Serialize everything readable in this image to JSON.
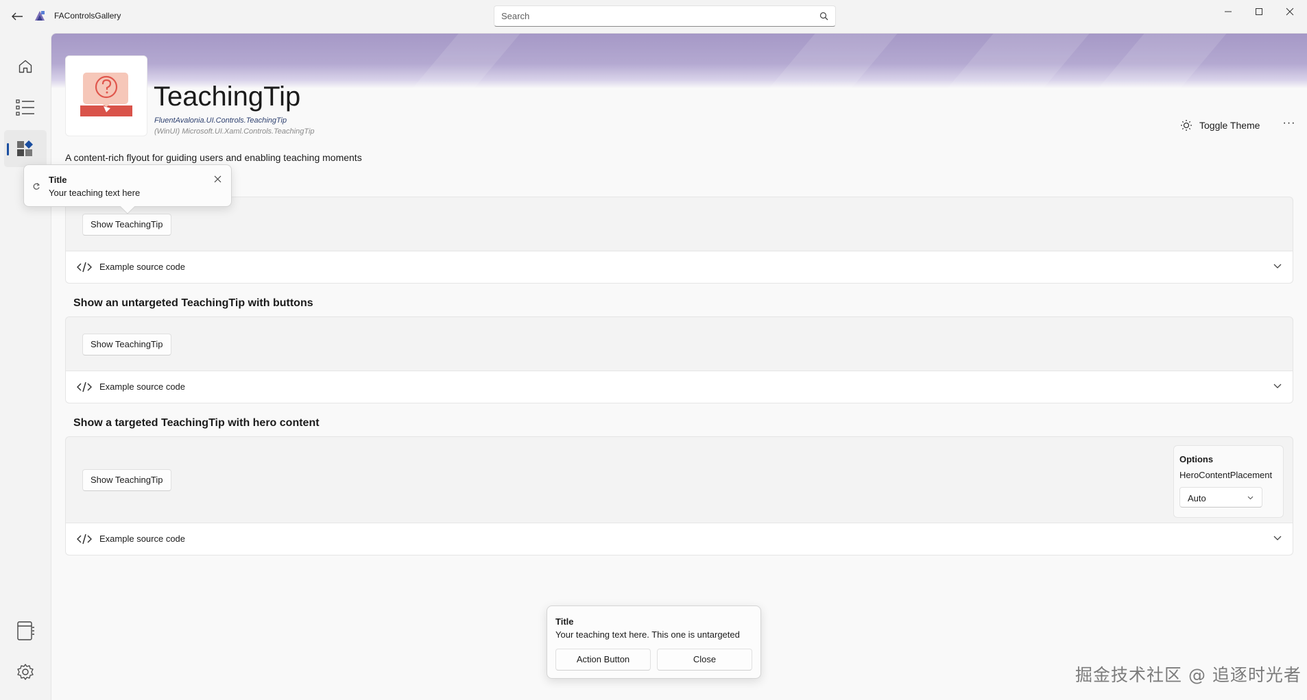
{
  "app": {
    "title": "FAControlsGallery"
  },
  "search": {
    "placeholder": "Search"
  },
  "nav": {
    "items": [
      {
        "icon": "home-icon"
      },
      {
        "icon": "list-icon"
      },
      {
        "icon": "controls-icon",
        "active": true
      }
    ],
    "footer": [
      {
        "icon": "notebook-icon"
      },
      {
        "icon": "gear-icon"
      }
    ]
  },
  "header": {
    "title": "TeachingTip",
    "namespace": "FluentAvalonia.UI.Controls.TeachingTip",
    "winui_namespace": "(WinUI) Microsoft.UI.Xaml.Controls.TeachingTip",
    "toggle_theme": "Toggle Theme",
    "more": "···",
    "description": "A content-rich flyout for guiding users and enabling teaching moments"
  },
  "examples": [
    {
      "heading": "",
      "button": "Show TeachingTip",
      "source_label": "Example source code"
    },
    {
      "heading": "Show an untargeted TeachingTip with buttons",
      "button": "Show TeachingTip",
      "source_label": "Example source code"
    },
    {
      "heading": "Show a targeted TeachingTip with hero content",
      "button": "Show TeachingTip",
      "source_label": "Example source code",
      "options": {
        "title": "Options",
        "label": "HeroContentPlacement",
        "value": "Auto"
      }
    }
  ],
  "tip_targeted": {
    "title": "Title",
    "text": "Your teaching text here"
  },
  "tip_untargeted": {
    "title": "Title",
    "text": "Your teaching text here. This one is untargeted",
    "action_button": "Action Button",
    "close_button": "Close"
  },
  "watermark": "掘金技术社区 @ 追逐时光者",
  "colors": {
    "accent": "#1a4ea0",
    "banner": "#a598c6",
    "hero_icon": "#e0574d"
  }
}
